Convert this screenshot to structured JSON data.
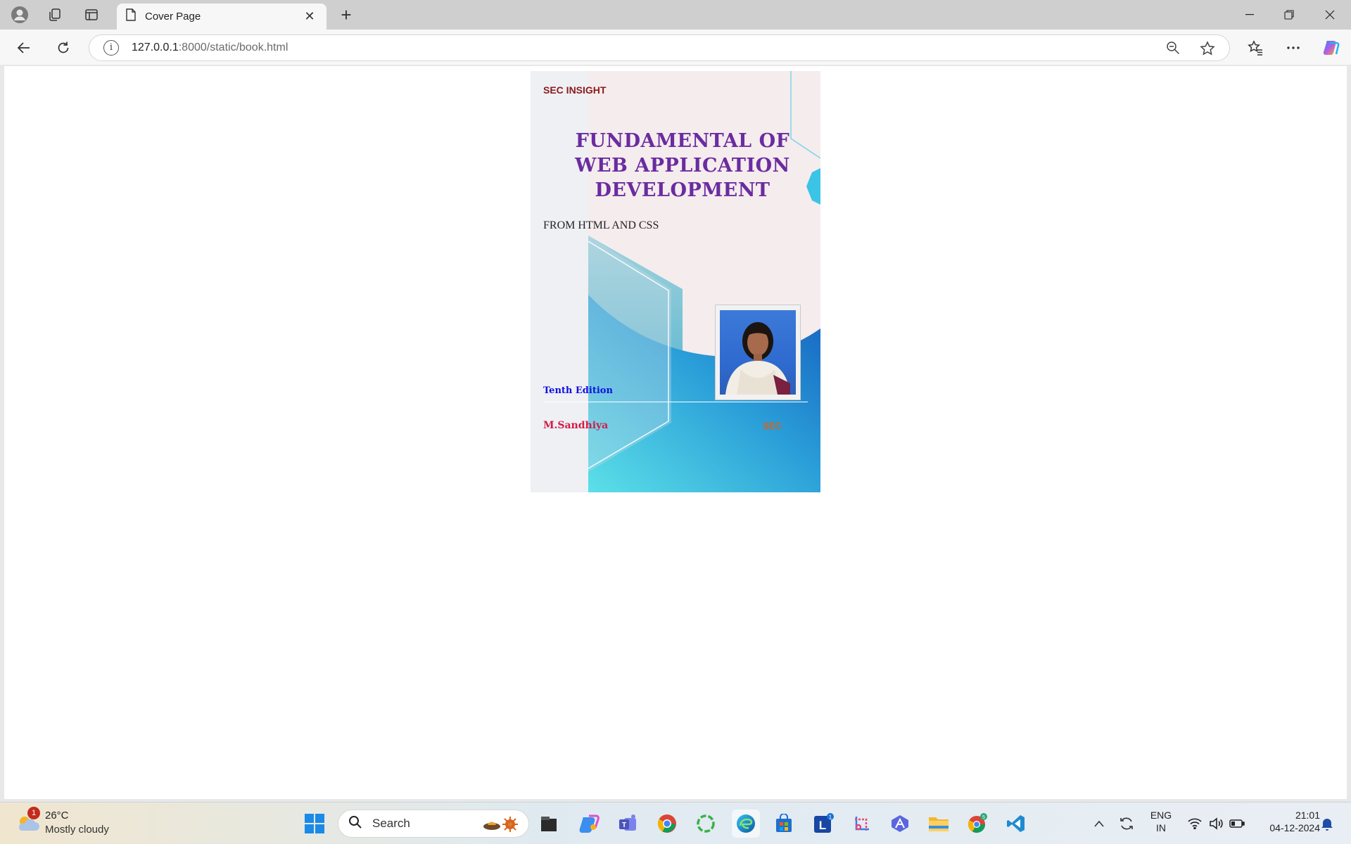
{
  "browser": {
    "tab_title": "Cover Page",
    "url_host": "127.0.0.1",
    "url_rest": ":8000/static/book.html"
  },
  "cover": {
    "brand": "SEC INSIGHT",
    "title_line1": "FUNDAMENTAL OF",
    "title_line2": "WEB APPLICATION",
    "title_line3": "DEVELOPMENT",
    "subtitle": "FROM HTML AND CSS",
    "edition": "Tenth Edition",
    "author": "M.Sandhiya",
    "publisher": "SEC",
    "colors": {
      "title": "#6a2ca0",
      "brand": "#8b1a1a",
      "edition": "#1010e0",
      "author": "#d41b48",
      "publisher": "#e06010",
      "wave_light": "#5ce0e8",
      "wave_dark": "#1560c0"
    }
  },
  "taskbar": {
    "weather_temp": "26°C",
    "weather_desc": "Mostly cloudy",
    "weather_badge": "1",
    "search_placeholder": "Search",
    "lang_line1": "ENG",
    "lang_line2": "IN",
    "time": "21:01",
    "date": "04-12-2024",
    "icons": [
      "start-icon",
      "search-icon",
      "file-explorer-dark-icon",
      "copilot-icon",
      "teams-icon",
      "chrome-icon",
      "ring-app-icon",
      "edge-icon",
      "store-icon",
      "l-app-icon",
      "snipping-tool-icon",
      "app-icon",
      "file-explorer-icon",
      "chrome-profile-icon",
      "vscode-icon"
    ]
  }
}
